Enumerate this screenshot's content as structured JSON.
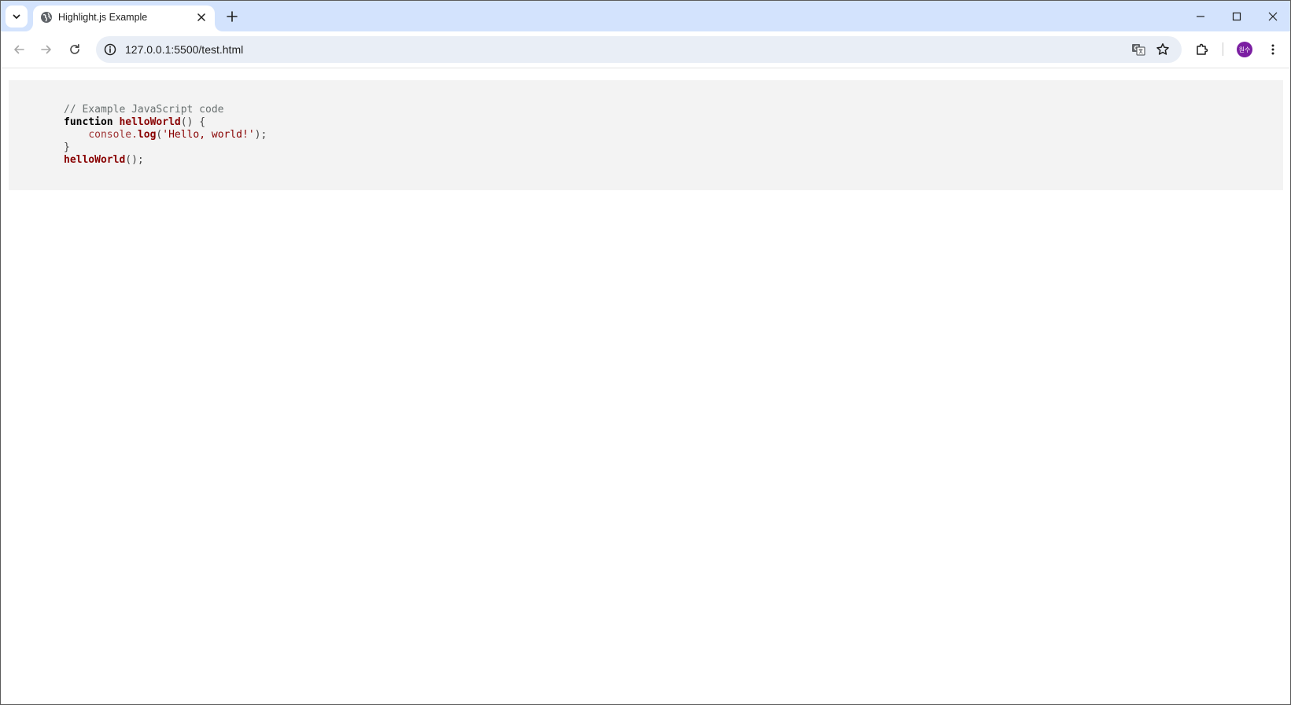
{
  "browser": {
    "tab": {
      "title": "Highlight.js Example"
    },
    "address_bar": {
      "url": "127.0.0.1:5500/test.html"
    },
    "profile": {
      "initials": "원수",
      "color": "#7b1fa2"
    },
    "colors": {
      "tabstrip": "#d3e3fd",
      "omnibox": "#e9eef6"
    }
  },
  "code": {
    "background": "#f3f3f3",
    "line1": {
      "comment": "// Example JavaScript code"
    },
    "line2": {
      "keyword": "function",
      "name": "helloWorld",
      "rest": "() {"
    },
    "line3": {
      "indent": "    ",
      "builtin": "console.",
      "method": "log",
      "open": "(",
      "string": "'Hello, world!'",
      "close": ");"
    },
    "line4": {
      "brace": "}"
    },
    "line5": {
      "call": "helloWorld",
      "rest": "();"
    }
  }
}
